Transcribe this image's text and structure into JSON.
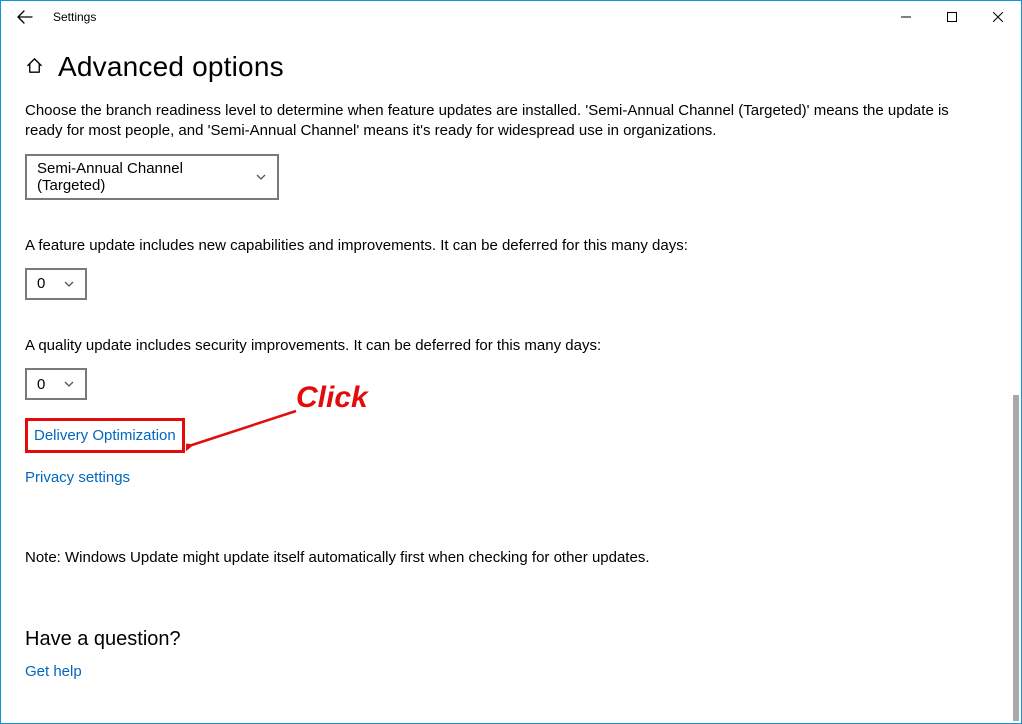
{
  "window": {
    "title": "Settings"
  },
  "page": {
    "heading": "Advanced options",
    "intro": "Choose the branch readiness level to determine when feature updates are installed. 'Semi-Annual Channel (Targeted)' means the update is ready for most people, and 'Semi-Annual Channel' means it's ready for widespread use in organizations.",
    "branch_dropdown": {
      "value": "Semi-Annual Channel (Targeted)"
    },
    "feature_update_text": "A feature update includes new capabilities and improvements. It can be deferred for this many days:",
    "feature_defer_dropdown": {
      "value": "0"
    },
    "quality_update_text": "A quality update includes security improvements. It can be deferred for this many days:",
    "quality_defer_dropdown": {
      "value": "0"
    },
    "links": {
      "delivery_optimization": "Delivery Optimization",
      "privacy_settings": "Privacy settings"
    },
    "note": "Note: Windows Update might update itself automatically first when checking for other updates.",
    "question_heading": "Have a question?",
    "get_help_link": "Get help"
  },
  "annotation": {
    "label": "Click"
  }
}
